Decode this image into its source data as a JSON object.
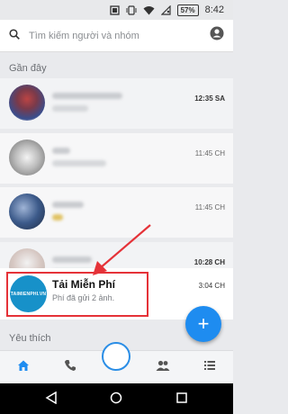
{
  "statusbar": {
    "battery": "57%",
    "time": "8:42"
  },
  "search": {
    "placeholder": "Tìm kiếm người và nhóm"
  },
  "sections": {
    "recent": "Gần đây",
    "favorites": "Yêu thích"
  },
  "conversations": [
    {
      "time": "12:35 SA",
      "bold": true
    },
    {
      "time": "11:45 CH",
      "bold": false
    },
    {
      "time": "11:45 CH",
      "bold": false
    },
    {
      "time": "10:28 CH",
      "bold": true
    }
  ],
  "highlighted": {
    "avatar_text": "TAIMIENPHI.VN",
    "name": "Tải Miễn Phí",
    "message": "Phí đã gửi 2 ảnh.",
    "time": "3:04 CH"
  },
  "colors": {
    "accent": "#1e8cf0",
    "highlight_box": "#e53238"
  },
  "tabs": [
    "home-icon",
    "phone-icon",
    "camera-ring",
    "people-icon",
    "menu-icon"
  ]
}
